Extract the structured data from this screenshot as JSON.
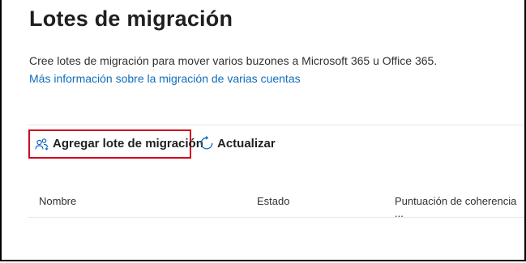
{
  "page": {
    "title": "Lotes de migración",
    "description": "Cree lotes de migración para mover varios buzones a Microsoft 365 u Office 365.",
    "learn_more_link": "Más información sobre la migración de varias cuentas"
  },
  "toolbar": {
    "add_batch_label": "Agregar lote de migración",
    "add_batch_icon": "add-people-icon",
    "refresh_label": "Actualizar",
    "refresh_icon": "refresh-icon"
  },
  "table": {
    "columns": [
      "Nombre",
      "Estado",
      "Puntuación de coherencia ..."
    ]
  },
  "colors": {
    "link": "#0f6cbd",
    "highlight": "#d0021b",
    "icon_blue": "#0f6cbd"
  }
}
